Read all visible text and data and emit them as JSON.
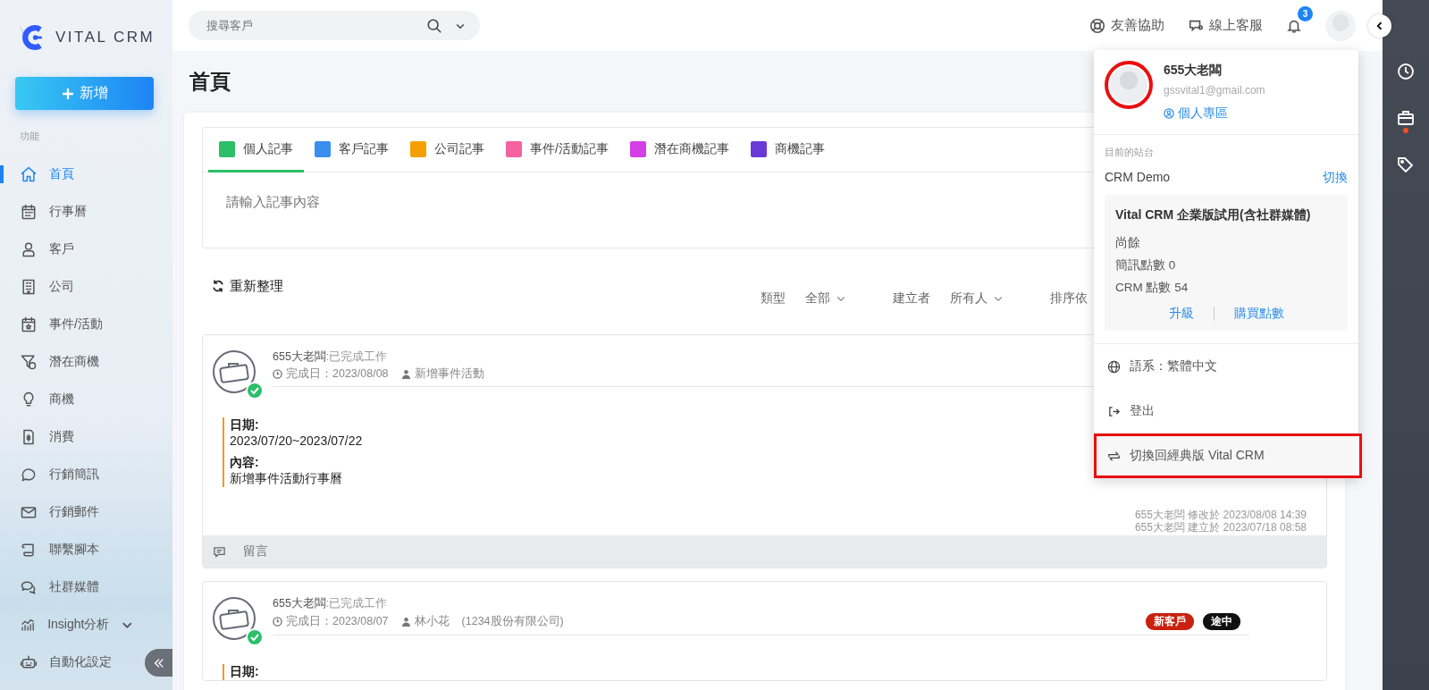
{
  "brand": {
    "name": "VITAL CRM"
  },
  "sidebar": {
    "new_button": "新增",
    "section": "功能",
    "items": [
      {
        "label": "首頁",
        "selected": true,
        "kind": "link"
      },
      {
        "label": "行事曆",
        "selected": false,
        "kind": "link"
      },
      {
        "label": "客戶",
        "selected": false,
        "kind": "link"
      },
      {
        "label": "公司",
        "selected": false,
        "kind": "link"
      },
      {
        "label": "事件/活動",
        "selected": false,
        "kind": "link"
      },
      {
        "label": "潛在商機",
        "selected": false,
        "kind": "link"
      },
      {
        "label": "商機",
        "selected": false,
        "kind": "link"
      },
      {
        "label": "消費",
        "selected": false,
        "kind": "link"
      },
      {
        "label": "行銷簡訊",
        "selected": false,
        "kind": "link"
      },
      {
        "label": "行銷郵件",
        "selected": false,
        "kind": "link"
      },
      {
        "label": "聯繫腳本",
        "selected": false,
        "kind": "link"
      },
      {
        "label": "社群媒體",
        "selected": false,
        "kind": "link"
      },
      {
        "label": "Insight分析",
        "selected": false,
        "kind": "group"
      },
      {
        "label": "自動化設定",
        "selected": false,
        "kind": "link"
      }
    ]
  },
  "topbar": {
    "search_placeholder": "搜尋客戶",
    "help": "友善協助",
    "support": "線上客服",
    "notification_count": "3"
  },
  "page_title": "首頁",
  "note_editor": {
    "tabs": [
      {
        "label": "個人記事",
        "color": "#2bbf6a",
        "selected": true
      },
      {
        "label": "客戶記事",
        "color": "#3a8ef0",
        "selected": false
      },
      {
        "label": "公司記事",
        "color": "#f5a000",
        "selected": false
      },
      {
        "label": "事件/活動記事",
        "color": "#f462a0",
        "selected": false
      },
      {
        "label": "潛在商機記事",
        "color": "#d43fe6",
        "selected": false
      },
      {
        "label": "商機記事",
        "color": "#6a3ad8",
        "selected": false
      }
    ],
    "placeholder": "請輸入記事內容"
  },
  "toolbar": {
    "refresh": "重新整理",
    "filters": [
      {
        "label": "類型",
        "value": "全部"
      },
      {
        "label": "建立者",
        "value": "所有人"
      },
      {
        "label": "排序依"
      }
    ]
  },
  "notes": [
    {
      "author": "655大老闆",
      "status": ":已完成工作",
      "done_date": "完成日：2023/08/08",
      "related": "新增事件活動",
      "fields": [
        {
          "label": "日期:",
          "value": "2023/07/20~2023/07/22"
        },
        {
          "label": "內容:",
          "value": "新增事件活動行事曆"
        }
      ],
      "modified": "655大老闆 修改於 2023/08/08 14:39",
      "created": "655大老闆 建立於 2023/07/18 08:58",
      "comment": "留言"
    },
    {
      "author": "655大老闆",
      "status": ":已完成工作",
      "done_date": "完成日：2023/08/07",
      "related": "林小花",
      "related_company": "(1234股份有限公司)",
      "tags": [
        {
          "label": "新客戶",
          "color": "#c8210e"
        },
        {
          "label": "途中",
          "color": "#111111"
        }
      ],
      "fields": [
        {
          "label": "日期:"
        }
      ]
    }
  ],
  "account_menu": {
    "name": "655大老闆",
    "email": "gssvital1@gmail.com",
    "avatar_highlighted": true,
    "profile_link": "個人專區",
    "site_label": "目前的站台",
    "site_name": "CRM Demo",
    "switch_site": "切換",
    "plan": {
      "title": "Vital CRM 企業版試用(含社群媒體)",
      "remaining": "尚餘",
      "sms_points": "簡訊點數 0",
      "crm_points": "CRM 點數 54",
      "upgrade": "升級",
      "buy_points": "購買點數"
    },
    "items": [
      {
        "label": "語系：繁體中文",
        "highlighted": false
      },
      {
        "label": "登出",
        "highlighted": false
      },
      {
        "label": "切換回經典版 Vital CRM",
        "highlighted": true
      }
    ]
  }
}
